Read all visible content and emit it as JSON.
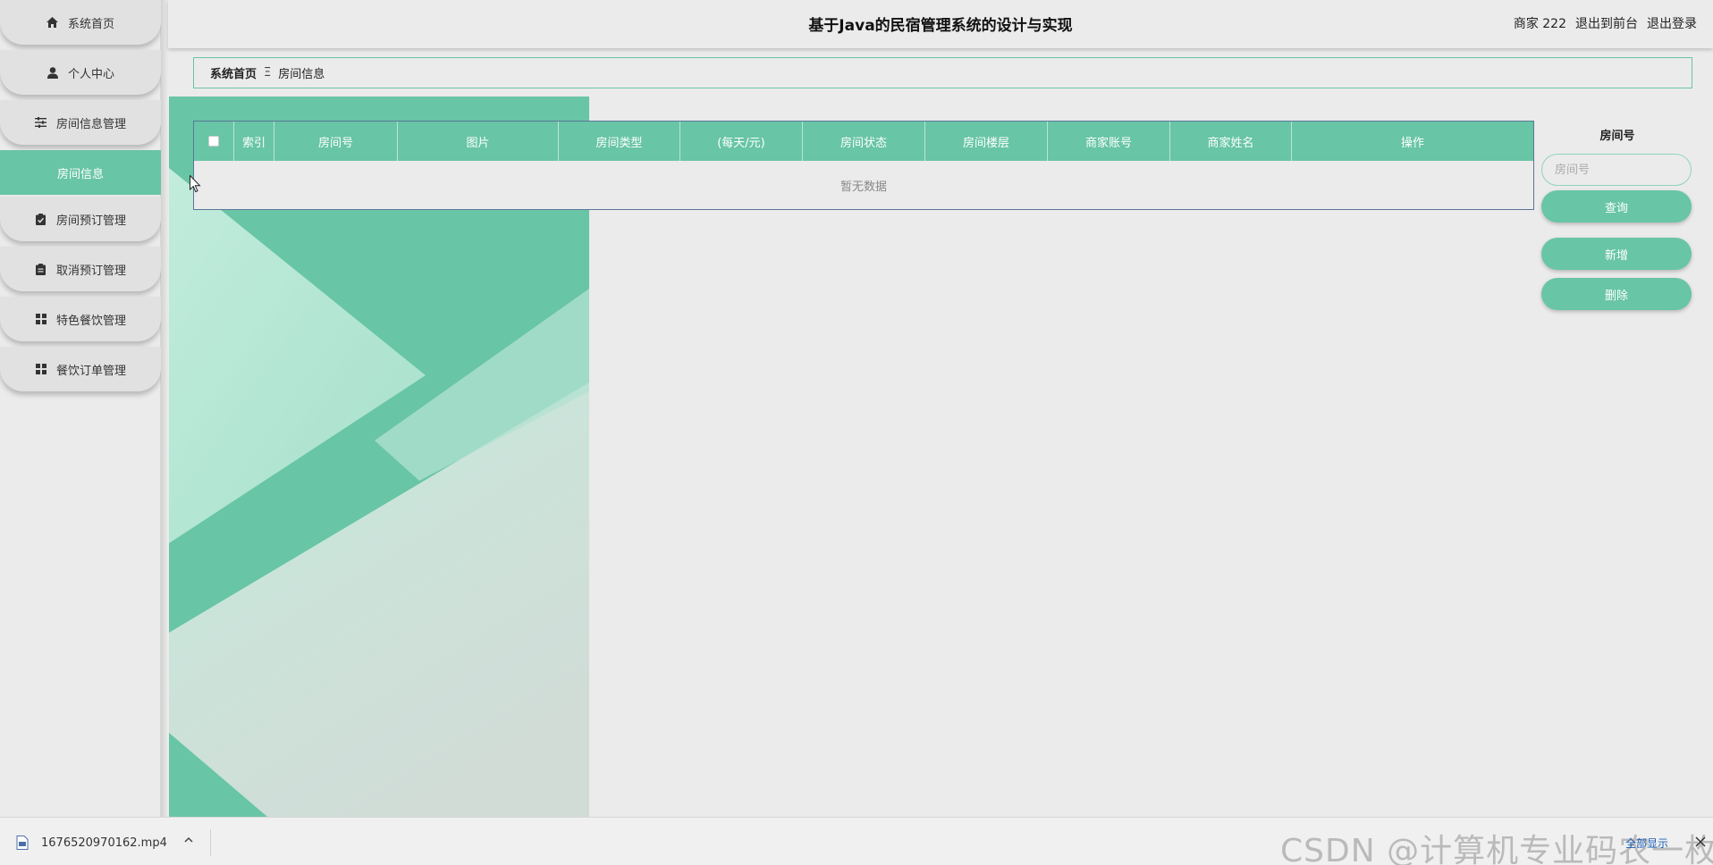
{
  "app": {
    "title": "基于Java的民宿管理系统的设计与实现"
  },
  "header": {
    "user_label": "商家 222",
    "front_link": "退出到前台",
    "logout_link": "退出登录"
  },
  "sidebar": {
    "items": [
      {
        "label": "系统首页",
        "icon": "home-icon"
      },
      {
        "label": "个人中心",
        "icon": "user-icon"
      },
      {
        "label": "房间信息管理",
        "icon": "sliders-icon"
      },
      {
        "label": "房间信息",
        "icon": "",
        "active": true
      },
      {
        "label": "房间预订管理",
        "icon": "clipboard-check-icon"
      },
      {
        "label": "取消预订管理",
        "icon": "clipboard-icon"
      },
      {
        "label": "特色餐饮管理",
        "icon": "grid-icon"
      },
      {
        "label": "餐饮订单管理",
        "icon": "grid-icon"
      }
    ]
  },
  "breadcrumb": {
    "home": "系统首页",
    "separator": "Ξ",
    "current": "房间信息"
  },
  "table": {
    "columns": [
      "索引",
      "房间号",
      "图片",
      "房间类型",
      "(每天/元)",
      "房间状态",
      "房间楼层",
      "商家账号",
      "商家姓名",
      "操作"
    ],
    "empty_text": "暂无数据"
  },
  "search": {
    "label": "房间号",
    "placeholder": "房间号",
    "value": "",
    "query_button": "查询",
    "add_button": "新增",
    "delete_button": "删除"
  },
  "download_bar": {
    "file_name": "1676520970162.mp4",
    "show_all": "全部显示",
    "watermark": "CSDN @计算机专业码农一枚"
  },
  "colors": {
    "accent": "#68c5a6",
    "background": "#ebebeb",
    "border": "#5a7796"
  }
}
